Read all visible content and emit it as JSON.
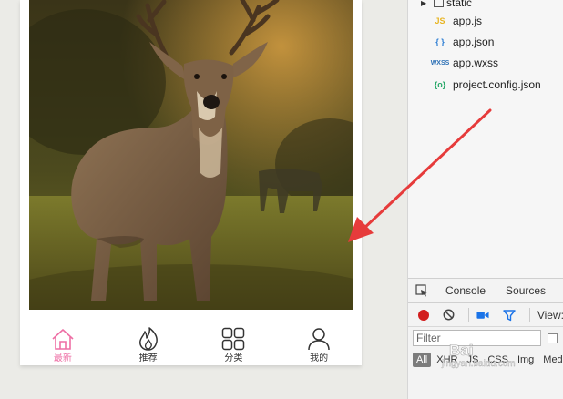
{
  "tabbar": {
    "items": [
      {
        "label": "最新",
        "icon": "home-icon",
        "active": true
      },
      {
        "label": "推荐",
        "icon": "flame-icon",
        "active": false
      },
      {
        "label": "分类",
        "icon": "grid-icon",
        "active": false
      },
      {
        "label": "我的",
        "icon": "user-icon",
        "active": false
      }
    ],
    "active_color": "#ee6fa5"
  },
  "file_tree": {
    "folder": "static",
    "files": [
      {
        "icon_text": "JS",
        "icon_color": "#e8b523",
        "name": "app.js"
      },
      {
        "icon_text": "{ }",
        "icon_color": "#2b7cd3",
        "name": "app.json"
      },
      {
        "icon_text": "WXSS",
        "icon_color": "#2b6fb5",
        "name": "app.wxss"
      },
      {
        "icon_text": "{o}",
        "icon_color": "#2aa86a",
        "name": "project.config.json"
      }
    ]
  },
  "devtools": {
    "tabs": [
      "Console",
      "Sources"
    ],
    "view_label": "View:",
    "filter_placeholder": "Filter",
    "types": [
      "All",
      "XHR",
      "JS",
      "CSS",
      "Img",
      "Med"
    ]
  },
  "watermark": {
    "line1": "Bai",
    "line2": "jingyan.baidu.com"
  },
  "annotation": {
    "arrow_color": "#e63b3b"
  }
}
